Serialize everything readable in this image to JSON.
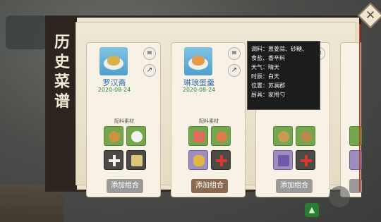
{
  "panel": {
    "title_chars": [
      "历",
      "史",
      "菜",
      "谱"
    ],
    "close_icon": "✕"
  },
  "recipes": [
    {
      "name": "罗汉斋",
      "date": "2020-08-24",
      "materials_label": "配料素材",
      "add_label": "添加组合",
      "add_style": "gray",
      "image_food_color": "#d9b24b",
      "materials": [
        {
          "icon": "bread-icon",
          "style": "green",
          "color": "#c99445"
        },
        {
          "icon": "rice-bowl-icon",
          "style": "green",
          "color": "#f5f3ee"
        },
        {
          "icon": "empty-slot-plus-icon",
          "style": "dark"
        },
        {
          "icon": "plant-icon",
          "style": "dark",
          "color": "#d9c87a"
        }
      ]
    },
    {
      "name": "琳琅蛋羹",
      "date": "2020-08-24",
      "materials_label": "配料素材",
      "add_label": "添加组合",
      "add_style": "brown",
      "image_food_color": "#e59b4a",
      "materials": [
        {
          "icon": "meat-icon",
          "style": "green",
          "color": "#e06b5a"
        },
        {
          "icon": "eggs-icon",
          "style": "green",
          "color": "#d9804a"
        },
        {
          "icon": "pineapple-icon",
          "style": "purple",
          "color": "#e1b741"
        },
        {
          "icon": "empty-slot-plus-icon",
          "style": "dark",
          "red": true
        }
      ]
    },
    {
      "name": "",
      "date": "",
      "materials_label": "",
      "add_label": "添加组合",
      "add_style": "gray",
      "image_food_color": "#cf9a3f",
      "materials": [
        {
          "icon": "rice-icon",
          "style": "green",
          "color": "#c89a55"
        },
        {
          "icon": "bowl-icon",
          "style": "green",
          "color": "#bb8a4a"
        },
        {
          "icon": "lavender-icon",
          "style": "purple",
          "color": "#6f5aa7"
        },
        {
          "icon": "empty-slot-plus-icon",
          "style": "dark",
          "red": true
        }
      ]
    }
  ],
  "tooltip": {
    "seasoning": "调料：葱姜蒜、砂糖、",
    "seasoning_2": "食盐、香辛料",
    "weather": "天气：晴天",
    "time": "时辰：白天",
    "location": "位置：苏澜郡",
    "utensil": "厨具：家用勺"
  },
  "colors": {
    "panel_dark": "#2b241f",
    "name_blue": "#2e6db1",
    "date_green": "#2d8a3a"
  }
}
